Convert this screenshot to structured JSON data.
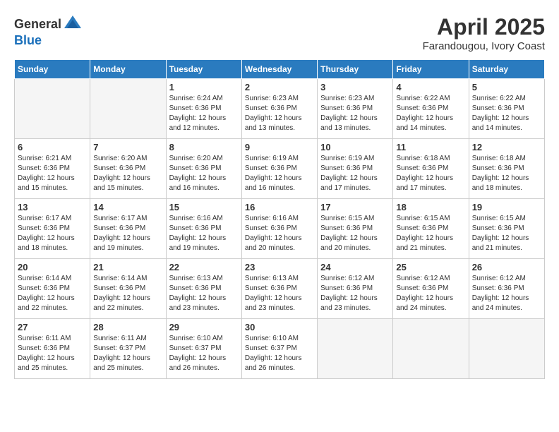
{
  "header": {
    "logo_general": "General",
    "logo_blue": "Blue",
    "title": "April 2025",
    "subtitle": "Farandougou, Ivory Coast"
  },
  "days_of_week": [
    "Sunday",
    "Monday",
    "Tuesday",
    "Wednesday",
    "Thursday",
    "Friday",
    "Saturday"
  ],
  "weeks": [
    {
      "shaded": false,
      "days": [
        {
          "num": "",
          "empty": true
        },
        {
          "num": "",
          "empty": true
        },
        {
          "num": "1",
          "sunrise": "6:24 AM",
          "sunset": "6:36 PM",
          "daylight": "12 hours and 12 minutes."
        },
        {
          "num": "2",
          "sunrise": "6:23 AM",
          "sunset": "6:36 PM",
          "daylight": "12 hours and 13 minutes."
        },
        {
          "num": "3",
          "sunrise": "6:23 AM",
          "sunset": "6:36 PM",
          "daylight": "12 hours and 13 minutes."
        },
        {
          "num": "4",
          "sunrise": "6:22 AM",
          "sunset": "6:36 PM",
          "daylight": "12 hours and 14 minutes."
        },
        {
          "num": "5",
          "sunrise": "6:22 AM",
          "sunset": "6:36 PM",
          "daylight": "12 hours and 14 minutes."
        }
      ]
    },
    {
      "shaded": true,
      "days": [
        {
          "num": "6",
          "sunrise": "6:21 AM",
          "sunset": "6:36 PM",
          "daylight": "12 hours and 15 minutes."
        },
        {
          "num": "7",
          "sunrise": "6:20 AM",
          "sunset": "6:36 PM",
          "daylight": "12 hours and 15 minutes."
        },
        {
          "num": "8",
          "sunrise": "6:20 AM",
          "sunset": "6:36 PM",
          "daylight": "12 hours and 16 minutes."
        },
        {
          "num": "9",
          "sunrise": "6:19 AM",
          "sunset": "6:36 PM",
          "daylight": "12 hours and 16 minutes."
        },
        {
          "num": "10",
          "sunrise": "6:19 AM",
          "sunset": "6:36 PM",
          "daylight": "12 hours and 17 minutes."
        },
        {
          "num": "11",
          "sunrise": "6:18 AM",
          "sunset": "6:36 PM",
          "daylight": "12 hours and 17 minutes."
        },
        {
          "num": "12",
          "sunrise": "6:18 AM",
          "sunset": "6:36 PM",
          "daylight": "12 hours and 18 minutes."
        }
      ]
    },
    {
      "shaded": false,
      "days": [
        {
          "num": "13",
          "sunrise": "6:17 AM",
          "sunset": "6:36 PM",
          "daylight": "12 hours and 18 minutes."
        },
        {
          "num": "14",
          "sunrise": "6:17 AM",
          "sunset": "6:36 PM",
          "daylight": "12 hours and 19 minutes."
        },
        {
          "num": "15",
          "sunrise": "6:16 AM",
          "sunset": "6:36 PM",
          "daylight": "12 hours and 19 minutes."
        },
        {
          "num": "16",
          "sunrise": "6:16 AM",
          "sunset": "6:36 PM",
          "daylight": "12 hours and 20 minutes."
        },
        {
          "num": "17",
          "sunrise": "6:15 AM",
          "sunset": "6:36 PM",
          "daylight": "12 hours and 20 minutes."
        },
        {
          "num": "18",
          "sunrise": "6:15 AM",
          "sunset": "6:36 PM",
          "daylight": "12 hours and 21 minutes."
        },
        {
          "num": "19",
          "sunrise": "6:15 AM",
          "sunset": "6:36 PM",
          "daylight": "12 hours and 21 minutes."
        }
      ]
    },
    {
      "shaded": true,
      "days": [
        {
          "num": "20",
          "sunrise": "6:14 AM",
          "sunset": "6:36 PM",
          "daylight": "12 hours and 22 minutes."
        },
        {
          "num": "21",
          "sunrise": "6:14 AM",
          "sunset": "6:36 PM",
          "daylight": "12 hours and 22 minutes."
        },
        {
          "num": "22",
          "sunrise": "6:13 AM",
          "sunset": "6:36 PM",
          "daylight": "12 hours and 23 minutes."
        },
        {
          "num": "23",
          "sunrise": "6:13 AM",
          "sunset": "6:36 PM",
          "daylight": "12 hours and 23 minutes."
        },
        {
          "num": "24",
          "sunrise": "6:12 AM",
          "sunset": "6:36 PM",
          "daylight": "12 hours and 23 minutes."
        },
        {
          "num": "25",
          "sunrise": "6:12 AM",
          "sunset": "6:36 PM",
          "daylight": "12 hours and 24 minutes."
        },
        {
          "num": "26",
          "sunrise": "6:12 AM",
          "sunset": "6:36 PM",
          "daylight": "12 hours and 24 minutes."
        }
      ]
    },
    {
      "shaded": false,
      "days": [
        {
          "num": "27",
          "sunrise": "6:11 AM",
          "sunset": "6:36 PM",
          "daylight": "12 hours and 25 minutes."
        },
        {
          "num": "28",
          "sunrise": "6:11 AM",
          "sunset": "6:37 PM",
          "daylight": "12 hours and 25 minutes."
        },
        {
          "num": "29",
          "sunrise": "6:10 AM",
          "sunset": "6:37 PM",
          "daylight": "12 hours and 26 minutes."
        },
        {
          "num": "30",
          "sunrise": "6:10 AM",
          "sunset": "6:37 PM",
          "daylight": "12 hours and 26 minutes."
        },
        {
          "num": "",
          "empty": true
        },
        {
          "num": "",
          "empty": true
        },
        {
          "num": "",
          "empty": true
        }
      ]
    }
  ]
}
